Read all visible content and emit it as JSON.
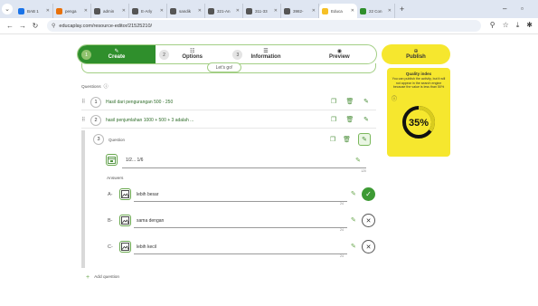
{
  "browser": {
    "tabs": [
      {
        "label": "BAB 1 ",
        "color": "#1a73e8"
      },
      {
        "label": "penga",
        "color": "#e8710a"
      },
      {
        "label": "admin",
        "color": "#555555"
      },
      {
        "label": "E-Arly",
        "color": "#555555"
      },
      {
        "label": "sandik",
        "color": "#555555"
      },
      {
        "label": "321-An",
        "color": "#555555"
      },
      {
        "label": "311-33",
        "color": "#555555"
      },
      {
        "label": "3982-",
        "color": "#555555"
      },
      {
        "label": "Educa",
        "color": "#f6c026",
        "active": true
      },
      {
        "label": "22 Con",
        "color": "#2f8f2c"
      }
    ],
    "url": "educaplay.com/resource-editor/21525210/"
  },
  "stepper": {
    "steps": [
      {
        "num": "1",
        "label": "Create"
      },
      {
        "num": "2",
        "label": "Options"
      },
      {
        "num": "3",
        "label": "Information"
      },
      {
        "label": "Preview"
      }
    ],
    "publish_label": "Publish",
    "letsgo_label": "Let's go!"
  },
  "quality": {
    "title": "Quality index",
    "description": "You can publish the activity, but it will not appear in the search engine because the value is less than 50%",
    "percent": 35,
    "percent_label": "35%"
  },
  "questions": {
    "header": "Questions",
    "items": [
      {
        "num": "1",
        "text": "Hasil dari pengurangan 500 - 250"
      },
      {
        "num": "2",
        "text": "hasil penjumlahan 1000 + 500 + 3 adalah ..."
      }
    ],
    "expanded": {
      "num": "3",
      "label": "Question",
      "text": "1/2... 1/6",
      "counter": "120",
      "answers_label": "Answers",
      "answers": [
        {
          "letter": "A-",
          "text": "lebih besar",
          "counter": "24",
          "correct": true
        },
        {
          "letter": "B-",
          "text": "sama dengan",
          "counter": "24",
          "correct": false
        },
        {
          "letter": "C-",
          "text": "lebih kecil",
          "counter": "24",
          "correct": false
        }
      ]
    },
    "add_label": "Add question"
  },
  "colors": {
    "accent_green": "#2f8f2c",
    "publish_yellow": "#f6e72e"
  }
}
